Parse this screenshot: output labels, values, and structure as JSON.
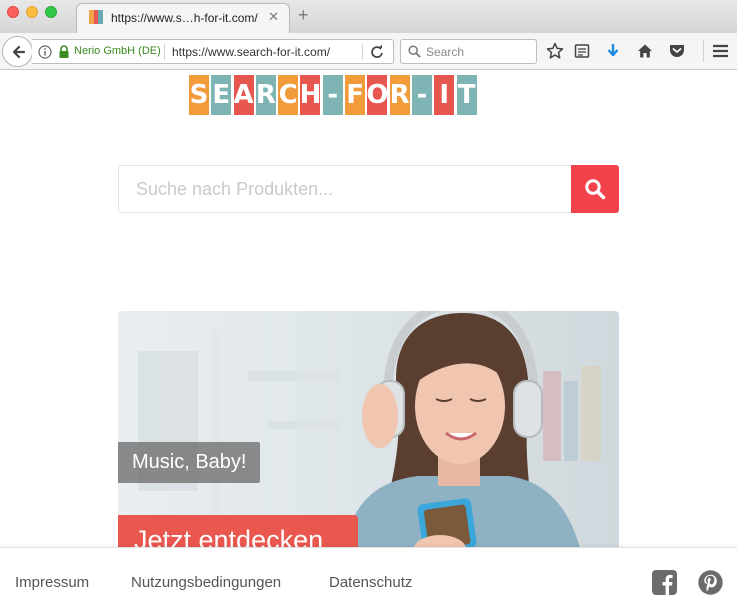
{
  "browser": {
    "tab": {
      "title": "https://www.s…h-for-it.com/",
      "favicon_colors": [
        "#f0a44a",
        "#e8574f",
        "#6aa8b0"
      ]
    },
    "nav": {
      "identity_label": "Nerio GmbH (DE)",
      "url": "https://www.search-for-it.com/",
      "search_placeholder": "Search"
    }
  },
  "page": {
    "logo": {
      "letters": [
        "S",
        "E",
        "A",
        "R",
        "C",
        "H",
        "-",
        "F",
        "O",
        "R",
        "-",
        "I",
        "T"
      ],
      "colors": [
        "#f29b3b",
        "#7fb4b4",
        "#e8574f",
        "#7fb4b4",
        "#f29b3b",
        "#e8574f",
        "#7fb4b4",
        "#f29b3b",
        "#e8574f",
        "#f29b3b",
        "#7fb4b4",
        "#e8574f",
        "#7fb4b4"
      ]
    },
    "search": {
      "placeholder": "Suche nach Produkten...",
      "button_color": "#f2434c"
    },
    "hero": {
      "caption": "Music, Baby!",
      "cta": "Jetzt entdecken"
    }
  },
  "footer": {
    "links": [
      "Impressum",
      "Nutzungsbedingungen",
      "Datenschutz"
    ],
    "social": [
      "facebook-icon",
      "pinterest-icon"
    ]
  }
}
